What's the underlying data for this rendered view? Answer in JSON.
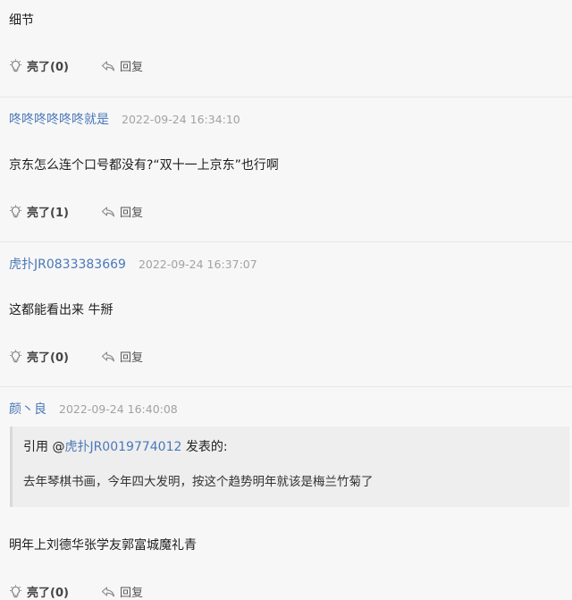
{
  "posts": [
    {
      "user": "",
      "time": "",
      "text": "细节",
      "like_label": "亮了(0)",
      "reply_label": "回复"
    },
    {
      "user": "咚咚咚咚咚咚就是",
      "time": "2022-09-24 16:34:10",
      "text": "京东怎么连个口号都没有?“双十一上京东”也行啊",
      "like_label": "亮了(1)",
      "reply_label": "回复"
    },
    {
      "user": "虎扑JR0833383669",
      "time": "2022-09-24 16:37:07",
      "text": "这都能看出来 牛掰",
      "like_label": "亮了(0)",
      "reply_label": "回复"
    },
    {
      "user": "颜丶良",
      "time": "2022-09-24 16:40:08",
      "quote": {
        "prefix": "引用 @",
        "user": "虎扑JR0019774012",
        "suffix": " 发表的:",
        "text": "去年琴棋书画，今年四大发明，按这个趋势明年就该是梅兰竹菊了"
      },
      "text": "明年上刘德华张学友郭富城魔礼青",
      "like_label": "亮了(0)",
      "reply_label": "回复"
    }
  ],
  "icons": {
    "like": "lightbulb-icon",
    "reply": "reply-arrow-icon"
  },
  "colors": {
    "username": "#4a78b8",
    "timestamp": "#a2a2a2",
    "quote_background": "#eeeeee"
  }
}
